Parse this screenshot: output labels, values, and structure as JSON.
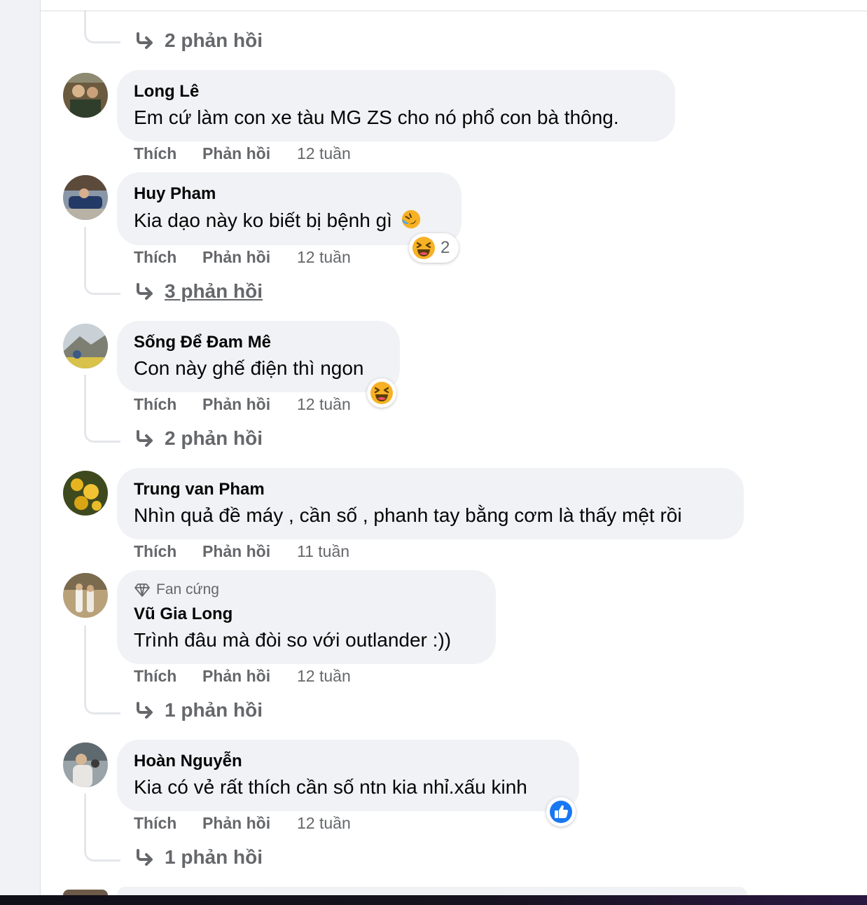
{
  "labels": {
    "like": "Thích",
    "reply": "Phản hồi"
  },
  "top_thread": {
    "replies": "2 phản hồi"
  },
  "comments": [
    {
      "author": "Long Lê",
      "text": "Em cứ làm con xe tàu MG ZS cho nó phổ con bà thông.",
      "time": "12 tuần"
    },
    {
      "author": "Huy Pham",
      "text": "Kia dạo này ko biết bị bệnh gì",
      "emoji_inline": "🤣",
      "time": "12 tuần",
      "reaction": {
        "icon": "haha-icon",
        "count": "2"
      },
      "replies": "3 phản hồi"
    },
    {
      "author": "Sống Để Đam Mê",
      "text": "Con này ghế điện thì ngon",
      "time": "12 tuần",
      "reaction": {
        "icon": "haha-icon"
      },
      "replies": "2 phản hồi"
    },
    {
      "author": "Trung van Pham",
      "text": "Nhìn quả đề máy , cần số , phanh tay bằng cơm là thấy mệt rồi",
      "time": "11 tuần"
    },
    {
      "badge": "Fan cứng",
      "badge_icon": "diamond-icon",
      "author": "Vũ Gia Long",
      "text": "Trình đâu mà đòi so với outlander :))",
      "time": "12 tuần",
      "replies": "1 phản hồi"
    },
    {
      "author": "Hoàn Nguyễn",
      "text": "Kia có vẻ rất thích cần số ntn kia nhỉ.xấu kinh",
      "time": "12 tuần",
      "reaction": {
        "icon": "like-icon"
      },
      "replies": "1 phản hồi"
    }
  ],
  "colors": {
    "bubble": "#f0f2f5",
    "meta": "#65676b",
    "like_blue": "#1877f2",
    "haha_yellow": "#f7b125"
  }
}
